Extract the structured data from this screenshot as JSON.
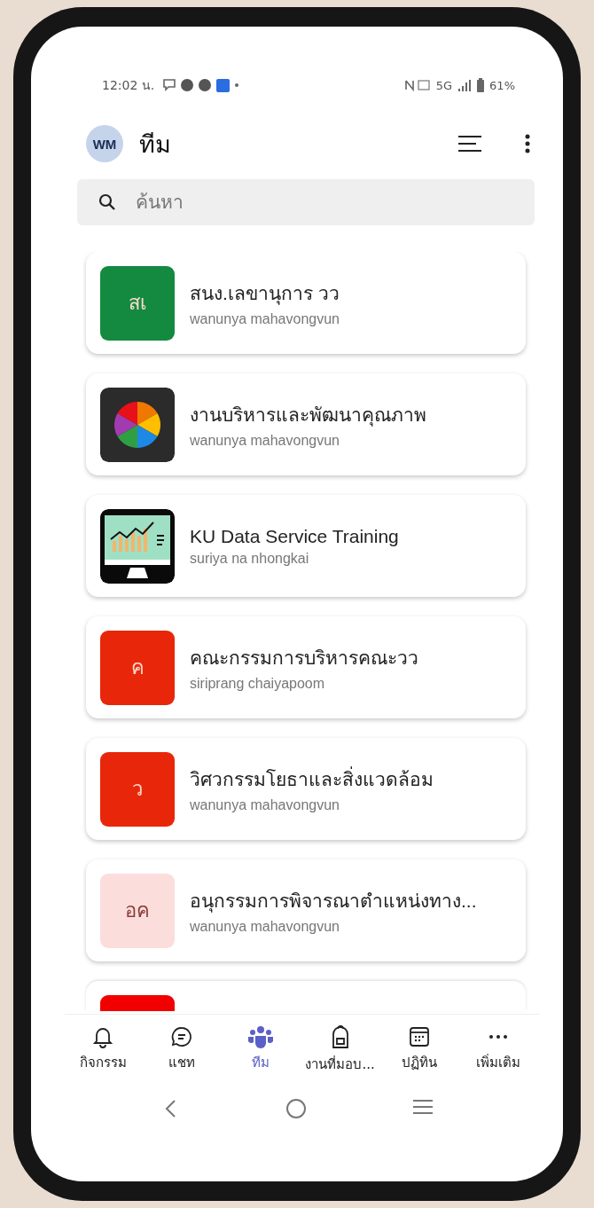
{
  "status_bar": {
    "time": "12:02 น.",
    "network": "5G",
    "battery": "61%"
  },
  "header": {
    "avatar": "WM",
    "title": "ทีม"
  },
  "search": {
    "placeholder": "ค้นหา"
  },
  "teams": [
    {
      "kind": "letters",
      "tile_text": "สเ",
      "color": "#138a3f",
      "title": "สนง.เลขานุการ วว",
      "owner": "wanunya mahavongvun"
    },
    {
      "kind": "pie",
      "color": "#2b2b2b",
      "title": "งานบริหารและพัฒนาคุณภาพ",
      "owner": "wanunya mahavongvun"
    },
    {
      "kind": "monitor",
      "color": "#0a0a0a",
      "title": "KU Data Service Training",
      "owner": "suriya na nhongkai"
    },
    {
      "kind": "letters",
      "tile_text": "ค",
      "color": "#e8270a",
      "title": "คณะกรรมการบริหารคณะวว",
      "owner": "siriprang chaiyapoom"
    },
    {
      "kind": "letters",
      "tile_text": "ว",
      "color": "#e8270a",
      "title": "วิศวกรรมโยธาและสิ่งแวดล้อม",
      "owner": "wanunya mahavongvun"
    },
    {
      "kind": "letters",
      "tile_text": "อค",
      "color": "#fbdedb",
      "title": "อนุกรรมการพิจารณาตำแหน่งทาง...",
      "owner": "wanunya mahavongvun"
    },
    {
      "kind": "partial",
      "color": "#f20000"
    }
  ],
  "bottom_nav": [
    {
      "kind": "bell",
      "label": "กิจกรรม",
      "selected": false
    },
    {
      "kind": "chat",
      "label": "แชท",
      "selected": false
    },
    {
      "kind": "teams",
      "label": "ทีม",
      "selected": true
    },
    {
      "kind": "bag",
      "label": "งานที่มอบ...",
      "selected": false
    },
    {
      "kind": "calendar",
      "label": "ปฏิทิน",
      "selected": false
    },
    {
      "kind": "more",
      "label": "เพิ่มเติม",
      "selected": false
    }
  ]
}
